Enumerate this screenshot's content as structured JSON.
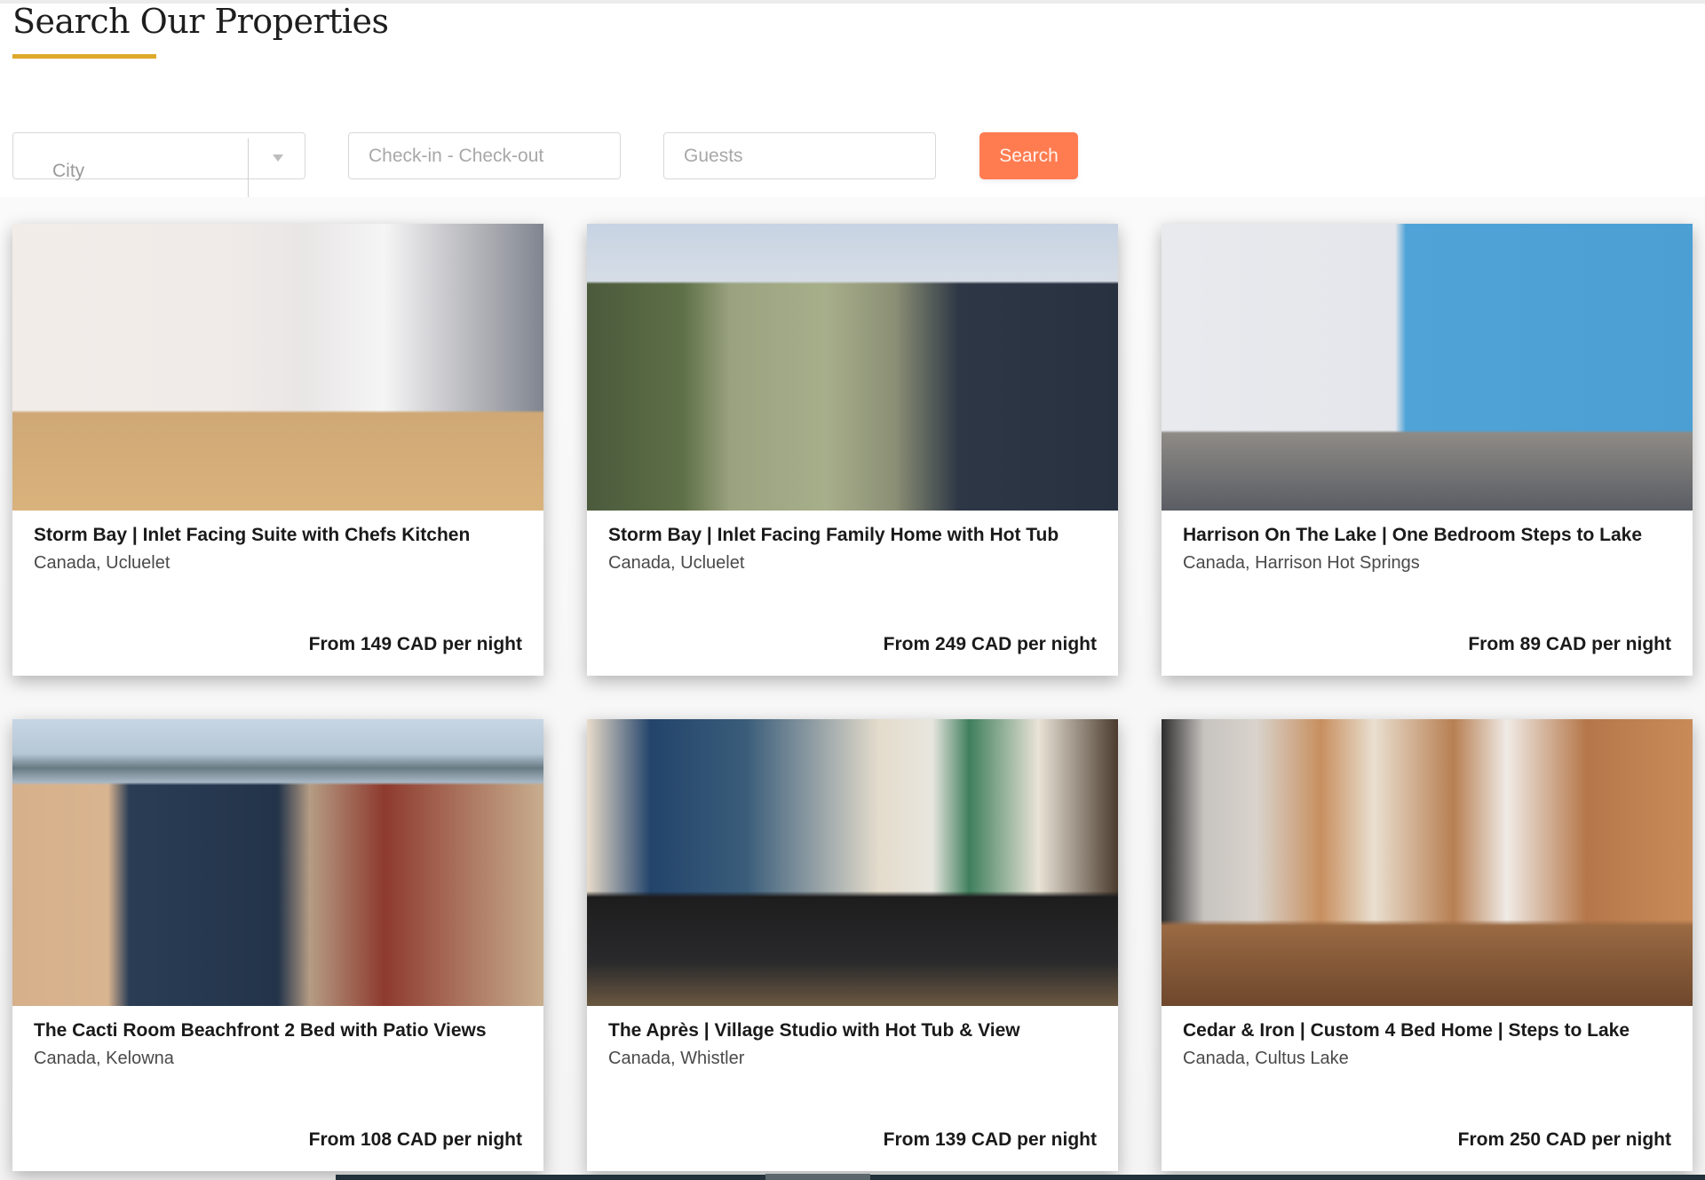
{
  "header": {
    "title": "Search Our Properties",
    "accent_color": "#dfa92a"
  },
  "search": {
    "city_placeholder": "City",
    "dates_placeholder": "Check-in - Check-out",
    "guests_placeholder": "Guests",
    "search_label": "Search",
    "button_color": "#ff7c51"
  },
  "properties": [
    {
      "name": "Storm Bay | Inlet Facing Suite with Chefs Kitchen",
      "location": "Canada, Ucluelet",
      "price": "From 149 CAD per night",
      "image": "kitchen-dining-interior"
    },
    {
      "name": "Storm Bay | Inlet Facing Family Home with Hot Tub",
      "location": "Canada, Ucluelet",
      "price": "From 249 CAD per night",
      "image": "house-exterior"
    },
    {
      "name": "Harrison On The Lake | One Bedroom Steps to Lake",
      "location": "Canada, Harrison Hot Springs",
      "price": "From 89 CAD per night",
      "image": "living-room-blue-wall"
    },
    {
      "name": "The Cacti Room Beachfront 2 Bed with Patio Views",
      "location": "Canada, Kelowna",
      "price": "From 108 CAD per night",
      "image": "lake-resort-view"
    },
    {
      "name": "The Après | Village Studio with Hot Tub & View",
      "location": "Canada, Whistler",
      "price": "From 139 CAD per night",
      "image": "studio-with-snowboards"
    },
    {
      "name": "Cedar & Iron | Custom 4 Bed Home | Steps to Lake",
      "location": "Canada, Cultus Lake",
      "price": "From 250 CAD per night",
      "image": "wood-kitchen-interior"
    }
  ]
}
